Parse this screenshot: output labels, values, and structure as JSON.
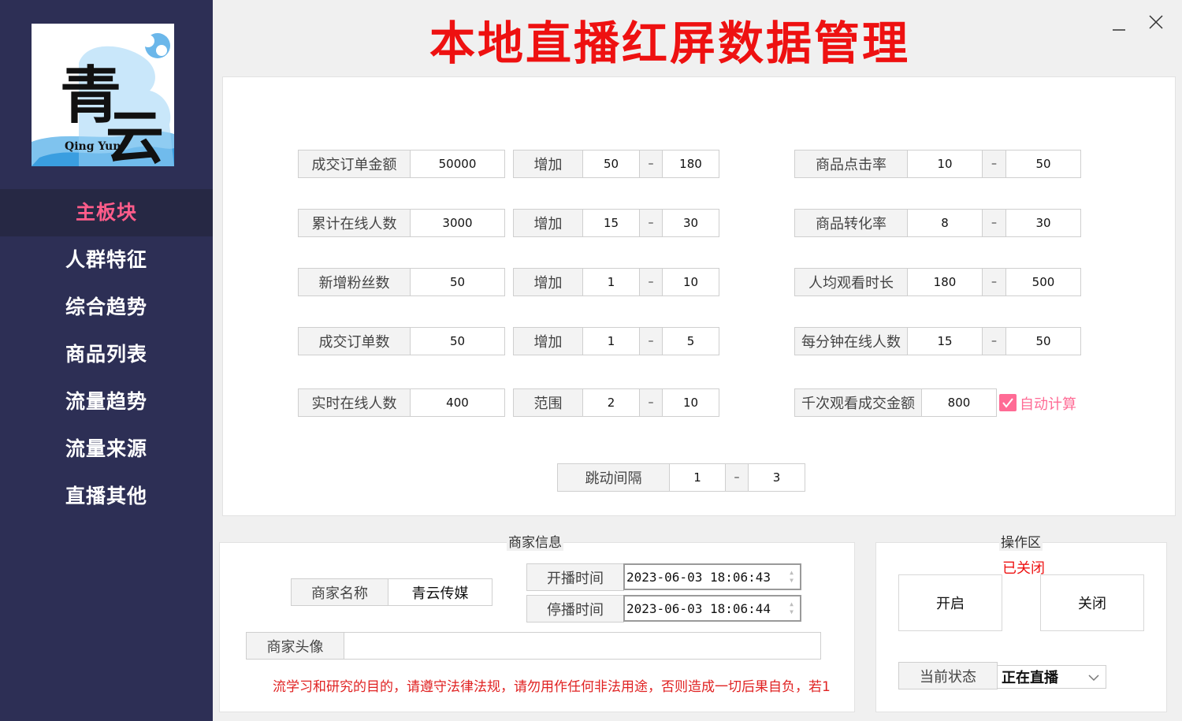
{
  "title": "本地直播红屏数据管理",
  "logo": {
    "char1": "青",
    "char2": "云",
    "text": "Qing Yun"
  },
  "sidebar": {
    "items": [
      {
        "label": "主板块",
        "active": true
      },
      {
        "label": "人群特征"
      },
      {
        "label": "综合趋势"
      },
      {
        "label": "商品列表"
      },
      {
        "label": "流量趋势"
      },
      {
        "label": "流量来源"
      },
      {
        "label": "直播其他"
      }
    ]
  },
  "params": {
    "dash": "–",
    "left": [
      {
        "label": "成交订单金额",
        "value": "50000",
        "op": "增加",
        "min": "50",
        "max": "180"
      },
      {
        "label": "累计在线人数",
        "value": "3000",
        "op": "增加",
        "min": "15",
        "max": "30"
      },
      {
        "label": "新增粉丝数",
        "value": "50",
        "op": "增加",
        "min": "1",
        "max": "10"
      },
      {
        "label": "成交订单数",
        "value": "50",
        "op": "增加",
        "min": "1",
        "max": "5"
      },
      {
        "label": "实时在线人数",
        "value": "400",
        "op": "范围",
        "min": "2",
        "max": "10"
      }
    ],
    "right": [
      {
        "label": "商品点击率",
        "min": "10",
        "max": "50"
      },
      {
        "label": "商品转化率",
        "min": "8",
        "max": "30"
      },
      {
        "label": "人均观看时长",
        "min": "180",
        "max": "500"
      },
      {
        "label": "每分钟在线人数",
        "min": "15",
        "max": "50"
      }
    ],
    "gmv_per_thousand": {
      "label": "千次观看成交金额",
      "value": "800",
      "auto_label": "自动计算",
      "auto_checked": true
    },
    "interval": {
      "label": "跳动间隔",
      "min": "1",
      "max": "3"
    }
  },
  "merchant": {
    "group_title": "商家信息",
    "name_label": "商家名称",
    "name_value": "青云传媒",
    "start_label": "开播时间",
    "start_value": "2023-06-03  18:06:43",
    "stop_label": "停播时间",
    "stop_value": "2023-06-03  18:06:44",
    "avatar_label": "商家头像",
    "avatar_value": "",
    "disclaimer": "流学习和研究的目的，请遵守法律法规，请勿用作任何非法用途，否则造成一切后果自负，若1"
  },
  "ops": {
    "group_title": "操作区",
    "status_text": "已关闭",
    "open_label": "开启",
    "close_label": "关闭",
    "current_status_label": "当前状态",
    "current_status_value": "正在直播"
  },
  "colors": {
    "sidebar_bg": "#2d2f55",
    "accent_pink": "#ff5c8a",
    "title_red": "#ee1111"
  }
}
